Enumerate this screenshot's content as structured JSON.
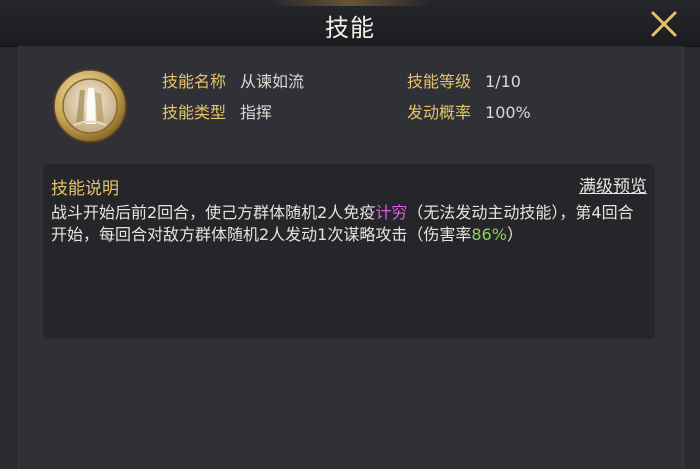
{
  "title": "技能",
  "icons": {
    "close": "close-x-icon",
    "skill": "waterfall-skill-emblem-icon"
  },
  "colors": {
    "label": "#e6c36a",
    "keyword": "#e05ce6",
    "percent": "#8fd05a"
  },
  "skill_info": {
    "name_label": "技能名称",
    "name_value": "从谏如流",
    "level_label": "技能等级",
    "level_value": "1/10",
    "type_label": "技能类型",
    "type_value": "指挥",
    "chance_label": "发动概率",
    "chance_value": "100%"
  },
  "description": {
    "title": "技能说明",
    "preview_link": "满级预览",
    "part1": "战斗开始后前2回合，使己方群体随机2人免疫",
    "keyword": "计穷",
    "part2": "（无法发动主动技能），第4回合开始，每回合对敌方群体随机2人发动1次谋略攻击（伤害率",
    "percent": "86%",
    "part3": "）"
  }
}
